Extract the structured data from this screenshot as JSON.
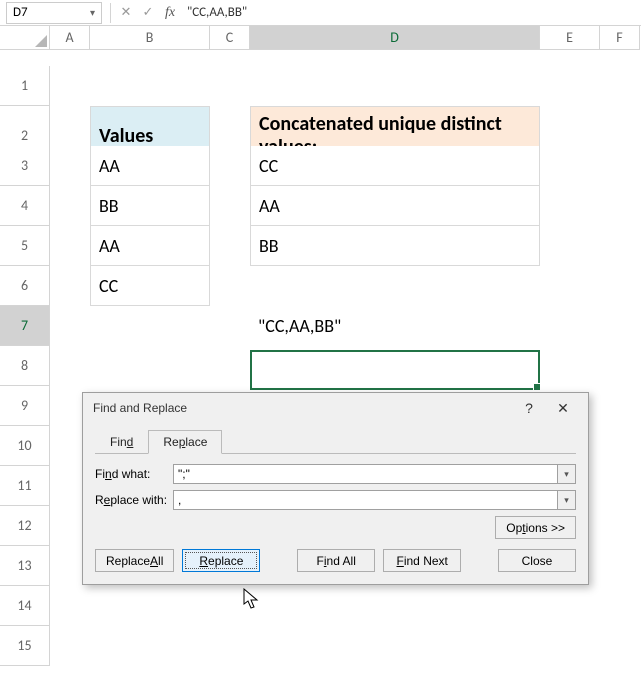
{
  "name_box": "D7",
  "formula_bar": "\"CC,AA,BB\"",
  "columns": [
    "A",
    "B",
    "C",
    "D",
    "E",
    "F"
  ],
  "rows": [
    "1",
    "2",
    "3",
    "4",
    "5",
    "6",
    "7",
    "8",
    "9",
    "10",
    "11",
    "12",
    "13",
    "14",
    "15"
  ],
  "active_col": "D",
  "active_row": "7",
  "headers": {
    "values": "Values",
    "concat": "Concatenated unique distinct values:"
  },
  "col_b": [
    "AA",
    "BB",
    "AA",
    "CC"
  ],
  "col_d": [
    "CC",
    "AA",
    "BB"
  ],
  "d7": "\"CC,AA,BB\"",
  "dialog": {
    "title": "Find and Replace",
    "tab_find": "Find",
    "tab_replace": "Replace",
    "find_label": "Find what:",
    "replace_label": "Replace with:",
    "find_value": "\";\"",
    "replace_value": ",",
    "options": "Options >>",
    "btn_replace_all": "Replace All",
    "btn_replace": "Replace",
    "btn_find_all": "Find All",
    "btn_find_next": "Find Next",
    "btn_close": "Close"
  }
}
